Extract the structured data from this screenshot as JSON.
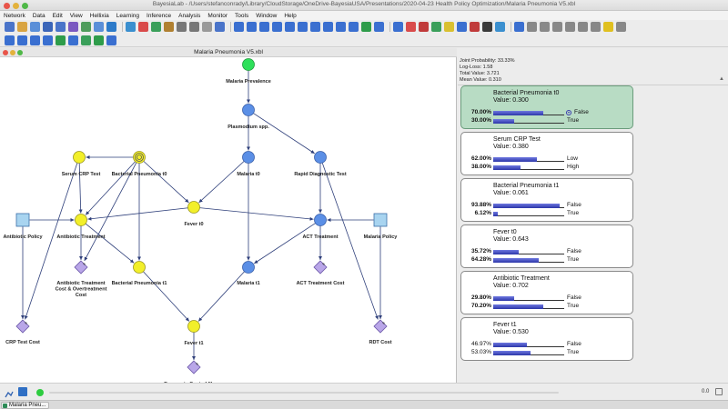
{
  "window": {
    "title": "BayesiaLab - /Users/stefanconrady/Library/CloudStorage/OneDrive-BayesiaUSA/Presentations/2020-04-23 Health Policy Optimization/Malaria Pneumonia V5.xbl"
  },
  "menu": [
    "Network",
    "Data",
    "Edit",
    "View",
    "Hellixia",
    "Learning",
    "Inference",
    "Analysis",
    "Monitor",
    "Tools",
    "Window",
    "Help"
  ],
  "graph": {
    "title": "Malaria Pneumonia V5.xbl",
    "nodes": [
      {
        "id": "malaria_prevalence",
        "label": "Malaria Prevalence",
        "kind": "root"
      },
      {
        "id": "plasmodium",
        "label": "Plasmodium spp.",
        "kind": "chance"
      },
      {
        "id": "serum_crp",
        "label": "Serum CRP Test",
        "kind": "chance-yellow"
      },
      {
        "id": "bact_pneu_t0",
        "label": "Bacterial Pneumonia t0",
        "kind": "target"
      },
      {
        "id": "malaria_t0",
        "label": "Malaria t0",
        "kind": "chance"
      },
      {
        "id": "rdt",
        "label": "Rapid Diagnostic Test",
        "kind": "chance"
      },
      {
        "id": "fever_t0",
        "label": "Fever t0",
        "kind": "chance-yellow"
      },
      {
        "id": "antibiotic_policy",
        "label": "Antibiotic Policy",
        "kind": "decision"
      },
      {
        "id": "antibiotic_treatment",
        "label": "Antibiotic Treatment",
        "kind": "chance-yellow"
      },
      {
        "id": "act_treatment",
        "label": "ACT Treatment",
        "kind": "chance"
      },
      {
        "id": "malaria_policy",
        "label": "Malaria Policy",
        "kind": "decision"
      },
      {
        "id": "abx_cost",
        "label": "Antibiotic Treatment Cost & Overtreatment Cost",
        "kind": "utility"
      },
      {
        "id": "bact_pneu_t1",
        "label": "Bacterial Pneumonia t1",
        "kind": "chance-yellow"
      },
      {
        "id": "malaria_t1",
        "label": "Malaria t1",
        "kind": "chance"
      },
      {
        "id": "act_cost",
        "label": "ACT Treatment Cost",
        "kind": "utility"
      },
      {
        "id": "crp_cost",
        "label": "CRP Test Cost",
        "kind": "utility"
      },
      {
        "id": "fever_t1",
        "label": "Fever t1",
        "kind": "chance-yellow"
      },
      {
        "id": "rdt_cost",
        "label": "RDT Cost",
        "kind": "utility"
      },
      {
        "id": "econ_cost",
        "label": "Economic Cost of Illness",
        "kind": "utility"
      }
    ],
    "edges": [
      [
        "malaria_prevalence",
        "plasmodium"
      ],
      [
        "plasmodium",
        "malaria_t0"
      ],
      [
        "plasmodium",
        "rdt"
      ],
      [
        "bact_pneu_t0",
        "serum_crp"
      ],
      [
        "bact_pneu_t0",
        "fever_t0"
      ],
      [
        "bact_pneu_t0",
        "bact_pneu_t1"
      ],
      [
        "bact_pneu_t0",
        "abx_cost"
      ],
      [
        "bact_pneu_t0",
        "antibiotic_treatment"
      ],
      [
        "malaria_t0",
        "fever_t0"
      ],
      [
        "malaria_t0",
        "malaria_t1"
      ],
      [
        "rdt",
        "act_treatment"
      ],
      [
        "serum_crp",
        "antibiotic_treatment"
      ],
      [
        "serum_crp",
        "crp_cost"
      ],
      [
        "antibiotic_policy",
        "antibiotic_treatment"
      ],
      [
        "antibiotic_policy",
        "crp_cost"
      ],
      [
        "antibiotic_treatment",
        "bact_pneu_t1"
      ],
      [
        "antibiotic_treatment",
        "abx_cost"
      ],
      [
        "fever_t0",
        "antibiotic_treatment"
      ],
      [
        "fever_t0",
        "act_treatment"
      ],
      [
        "act_treatment",
        "malaria_t1"
      ],
      [
        "act_treatment",
        "act_cost"
      ],
      [
        "malaria_policy",
        "act_treatment"
      ],
      [
        "malaria_policy",
        "rdt_cost"
      ],
      [
        "rdt",
        "rdt_cost"
      ],
      [
        "bact_pneu_t1",
        "fever_t1"
      ],
      [
        "malaria_t1",
        "fever_t1"
      ],
      [
        "fever_t1",
        "econ_cost"
      ]
    ]
  },
  "stats": {
    "joint_probability": "Joint Probability: 33.33%",
    "log_loss": "Log-Loss: 1.58",
    "total_value": "Total Value: 3.721",
    "mean_value": "Mean Value: 0.310"
  },
  "monitors": [
    {
      "title": "Bacterial Pneumonia t0",
      "value": "Value: 0.300",
      "selected": true,
      "states": [
        {
          "pct": "70.00%",
          "p": 0.7,
          "label": "False",
          "bold": true,
          "evidence": true
        },
        {
          "pct": "30.00%",
          "p": 0.3,
          "label": "True",
          "bold": true
        }
      ]
    },
    {
      "title": "Serum CRP Test",
      "value": "Value: 0.380",
      "selected": false,
      "states": [
        {
          "pct": "62.00%",
          "p": 0.62,
          "label": "Low",
          "bold": true
        },
        {
          "pct": "38.00%",
          "p": 0.38,
          "label": "High",
          "bold": true
        }
      ]
    },
    {
      "title": "Bacterial Pneumonia t1",
      "value": "Value: 0.061",
      "selected": false,
      "states": [
        {
          "pct": "93.88%",
          "p": 0.9388,
          "label": "False",
          "bold": true
        },
        {
          "pct": "6.12%",
          "p": 0.0612,
          "label": "True",
          "bold": true
        }
      ]
    },
    {
      "title": "Fever t0",
      "value": "Value: 0.643",
      "selected": false,
      "states": [
        {
          "pct": "35.72%",
          "p": 0.3572,
          "label": "False",
          "bold": true
        },
        {
          "pct": "64.28%",
          "p": 0.6428,
          "label": "True",
          "bold": true
        }
      ]
    },
    {
      "title": "Antibiotic Treatment",
      "value": "Value: 0.702",
      "selected": false,
      "states": [
        {
          "pct": "29.80%",
          "p": 0.298,
          "label": "False",
          "bold": true
        },
        {
          "pct": "70.20%",
          "p": 0.702,
          "label": "True",
          "bold": true
        }
      ]
    },
    {
      "title": "Fever t1",
      "value": "Value: 0.530",
      "selected": false,
      "states": [
        {
          "pct": "46.97%",
          "p": 0.4697,
          "label": "False",
          "bold": false
        },
        {
          "pct": "53.03%",
          "p": 0.5303,
          "label": "True",
          "bold": false
        }
      ]
    }
  ],
  "status": {
    "zoom": "0.0"
  },
  "taskbar": {
    "tab_label": "Malaria Pneu..."
  },
  "colors": {
    "node_yellow": "#f2ef2a",
    "node_blue": "#5b8fe6",
    "node_green": "#2ee05a",
    "decision": "#a8d4f0",
    "utility": "#b9a6e8",
    "selected_monitor": "#b8dcc4",
    "bar": "#3a44c0"
  }
}
